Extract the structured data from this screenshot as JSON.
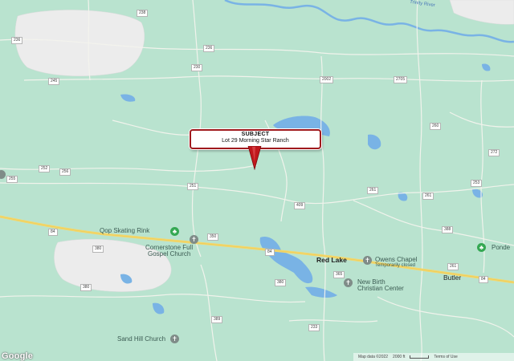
{
  "callout": {
    "title": "SUBJECT",
    "subtitle": "Lot 29 Morning Star Ranch"
  },
  "places": {
    "red_lake": "Red Lake",
    "butler": "Butler",
    "pond": "Ponde"
  },
  "pois": {
    "skating_rink": "Qop Skating Rink",
    "cornerstone_line1": "Cornerstone Full",
    "cornerstone_line2": "Gospel Church",
    "owens_line1": "Owens Chapel",
    "owens_line2": "Temporarily closed",
    "new_birth_line1": "New Birth",
    "new_birth_line2": "Christian Center",
    "sand_hill": "Sand Hill Church"
  },
  "water": {
    "river": "Trinity River"
  },
  "road_shields": {
    "r1": "238",
    "r2": "236",
    "r3": "230",
    "r4": "245",
    "r5": "236",
    "r6": "2002",
    "r7": "2705",
    "r8": "252",
    "r9": "255",
    "r10": "256",
    "r11": "260",
    "r12": "272",
    "r13": "251",
    "r14": "253",
    "r15": "409",
    "r16": "261",
    "r17": "84",
    "r18": "350",
    "r19": "84",
    "r20": "380",
    "r21": "380",
    "r22": "389",
    "r23": "261",
    "r24": "84",
    "r25": "380",
    "r26": "365",
    "r27": "233",
    "r28": "388",
    "r29": "261"
  },
  "footer": {
    "map_data": "Map data ©2022",
    "scale": "2000 ft",
    "terms": "Terms of Use"
  },
  "branding": {
    "google": "Google"
  },
  "icons": {
    "pin": "map-marker-icon",
    "place": "place-pin-icon",
    "cross": "church-cross-icon",
    "tree": "park-tree-icon"
  },
  "colors": {
    "land": "#b9e3cf",
    "water": "#7ab3e6",
    "road": "#f2f2ea",
    "highway": "#f4d86b",
    "pin_red": "#c0171c",
    "poi_grey": "#7f8c88",
    "park_green": "#35a853"
  }
}
